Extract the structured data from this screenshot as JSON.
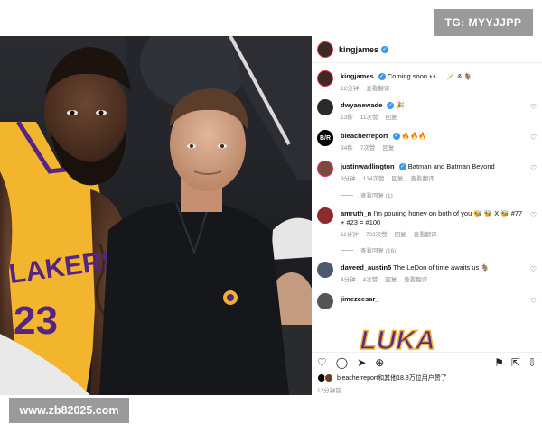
{
  "watermarks": {
    "top": "TG: MYYJJPP",
    "bottom": "www.zb82025.com"
  },
  "post": {
    "author": "kingjames",
    "comments": [
      {
        "user": "kingjames",
        "text": "Coming soon 👀 ... 🪄 & 🐐",
        "meta": [
          "12分钟",
          "查看翻译"
        ],
        "avatar": "kingjames",
        "heart": false
      },
      {
        "user": "dwyanewade",
        "text": "🎉",
        "meta": [
          "13秒",
          "11次赞",
          "回复"
        ],
        "avatar": "dwyanewade",
        "heart": true
      },
      {
        "user": "bleacherreport",
        "text": "🔥🔥🔥",
        "meta": [
          "34秒",
          "7次赞",
          "回复"
        ],
        "avatar": "B/R",
        "heart": true
      },
      {
        "user": "justinwadlington",
        "text": "Batman and Batman Beyond",
        "meta": [
          "9分钟",
          "134次赞",
          "回复",
          "查看翻译"
        ],
        "avatar": "justin",
        "heart": true,
        "replies": "查看回复 (1)"
      },
      {
        "user": "amruth_n",
        "text": "I'm pouring honey on both of you 🐝 🐝 X 🐝 #77 + #23 = #100",
        "meta": [
          "11分钟",
          "702次赞",
          "回复",
          "查看翻译"
        ],
        "avatar": "amruth",
        "heart": true,
        "replies": "查看回复 (16)"
      },
      {
        "user": "daveed_austin5",
        "text": "The LeDon of time awaits us 🐐",
        "meta": [
          "4分钟",
          "4次赞",
          "回复",
          "查看翻译"
        ],
        "avatar": "daveed",
        "heart": true
      },
      {
        "user": "jimezcesar_",
        "text": "",
        "meta": [],
        "avatar": "jimez",
        "heart": true
      }
    ],
    "sticker_text": "LUKA",
    "likes_text": "bleacherreport和其他18.8万位用户赞了",
    "post_time": "12分钟前",
    "icons": [
      "heart-icon",
      "comment-icon",
      "share-icon",
      "save-icon"
    ]
  },
  "photo": {
    "jersey_text": "LAKERS",
    "jersey_number": "23"
  },
  "colors": {
    "lakers_gold": "#f5b82e",
    "lakers_purple": "#552583",
    "verified": "#3897f0",
    "ring": "#d8325b"
  }
}
